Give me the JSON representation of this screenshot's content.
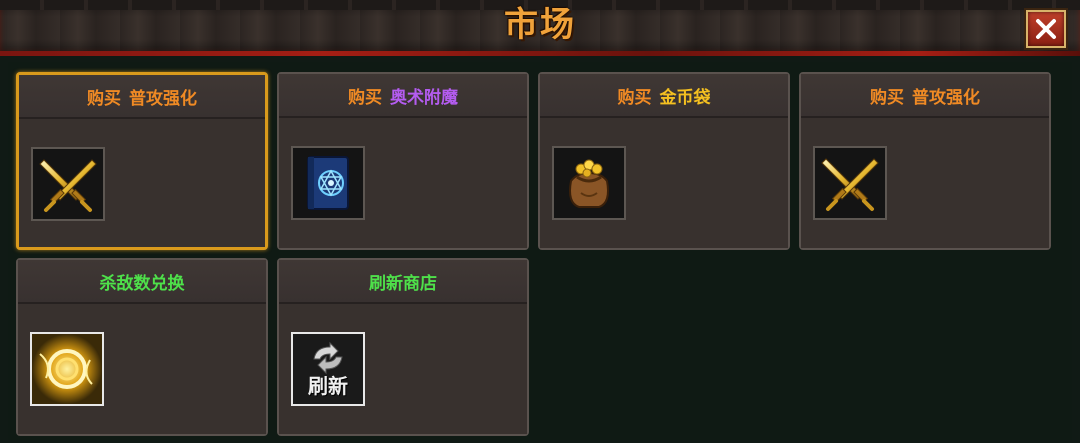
{
  "header": {
    "title": "市场"
  },
  "colors": {
    "buy_prefix": "#f08a24",
    "item_orange": "#f08a24",
    "item_purple": "#b45cf0",
    "item_gold": "#f4c020",
    "green_label": "#4ee04a",
    "selected_border": "#d99a1c"
  },
  "cards": [
    {
      "prefix": "购买",
      "name": "普攻强化",
      "icon": "crossed-swords-icon",
      "selected": true
    },
    {
      "prefix": "购买",
      "name": "奥术附魔",
      "icon": "arcane-tome-icon"
    },
    {
      "prefix": "购买",
      "name": "金币袋",
      "icon": "gold-bag-icon"
    },
    {
      "prefix": "购买",
      "name": "普攻强化",
      "icon": "crossed-swords-icon"
    },
    {
      "label": "杀敌数兑换",
      "icon": "golden-vortex-icon"
    },
    {
      "label": "刷新商店",
      "icon": "refresh-icon",
      "icon_text": "刷新"
    }
  ]
}
